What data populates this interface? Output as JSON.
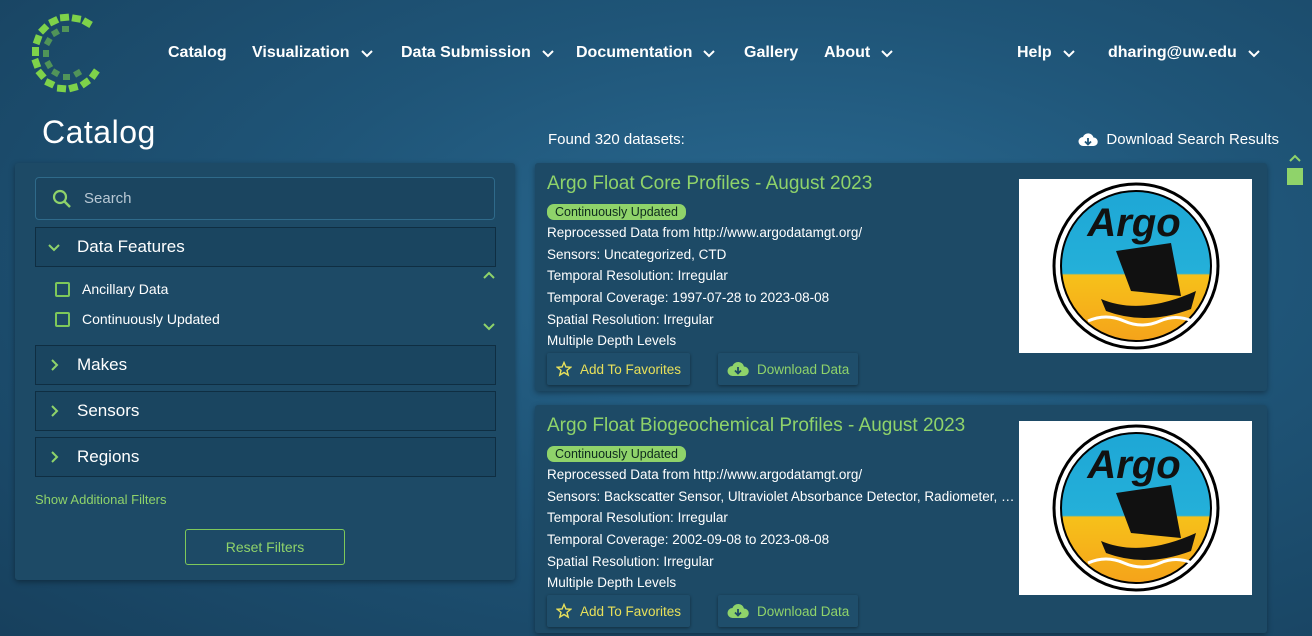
{
  "header": {
    "nav": [
      {
        "label": "Catalog",
        "dropdown": false
      },
      {
        "label": "Visualization",
        "dropdown": true
      },
      {
        "label": "Data Submission",
        "dropdown": true
      },
      {
        "label": "Documentation",
        "dropdown": true
      },
      {
        "label": "Gallery",
        "dropdown": false
      },
      {
        "label": "About",
        "dropdown": true
      }
    ],
    "help_label": "Help",
    "user_label": "dharing@uw.edu"
  },
  "page_title": "Catalog",
  "sidebar": {
    "search_placeholder": "Search",
    "facets": [
      {
        "label": "Data Features",
        "expanded": true
      },
      {
        "label": "Makes",
        "expanded": false
      },
      {
        "label": "Sensors",
        "expanded": false
      },
      {
        "label": "Regions",
        "expanded": false
      }
    ],
    "options": [
      "Ancillary Data",
      "Continuously Updated"
    ],
    "show_more": "Show Additional Filters",
    "reset": "Reset Filters"
  },
  "results": {
    "found": "Found 320 datasets:",
    "download_results": "Download Search Results",
    "cards": [
      {
        "title": "Argo Float Core Profiles - August 2023",
        "badge": "Continuously Updated",
        "lines": [
          "Reprocessed Data from http://www.argodatamgt.org/",
          "Sensors: Uncategorized, CTD",
          "Temporal Resolution: Irregular",
          "Temporal Coverage: 1997-07-28 to 2023-08-08",
          "Spatial Resolution: Irregular",
          "Multiple Depth Levels"
        ],
        "fav": "Add To Favorites",
        "download": "Download Data",
        "logo_text": "Argo"
      },
      {
        "title": "Argo Float Biogeochemical Profiles - August 2023",
        "badge": "Continuously Updated",
        "lines": [
          "Reprocessed Data from http://www.argodatamgt.org/",
          "Sensors: Backscatter Sensor, Ultraviolet Absorbance Detector, Radiometer, CTD",
          "Temporal Resolution: Irregular",
          "Temporal Coverage: 2002-09-08 to 2023-08-08",
          "Spatial Resolution: Irregular",
          "Multiple Depth Levels"
        ],
        "fav": "Add To Favorites",
        "download": "Download Data",
        "logo_text": "Argo"
      }
    ]
  },
  "colors": {
    "accent": "#8fd36a",
    "favorite": "#e8e05a",
    "panel": "#1d4a66"
  },
  "icons": [
    "logo-icon",
    "chevron-down-icon",
    "search-icon",
    "chevron-right-icon",
    "checkbox-icon",
    "cloud-download-icon",
    "star-icon",
    "scroll-up-icon",
    "scroll-down-icon"
  ]
}
